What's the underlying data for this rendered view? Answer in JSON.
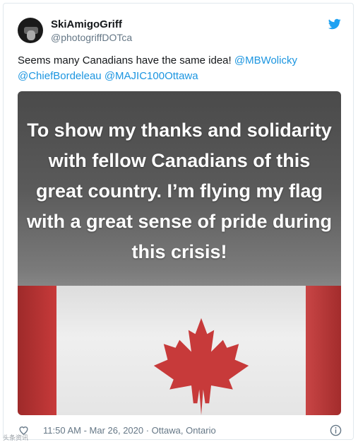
{
  "tweet": {
    "display_name": "SkiAmigoGriff",
    "handle": "@photogriffDOTca",
    "text_intro": "Seems many Canadians have the same idea! ",
    "mentions": [
      "@MBWolicky",
      "@ChiefBordeleau",
      "@MAJIC100Ottawa"
    ],
    "image_caption": "To show my thanks and solidarity with fellow Canadians of this great country. I’m flying my flag with a great sense of pride during this crisis!",
    "timestamp": "11:50 AM - Mar 26, 2020 · Ottawa, Ontario"
  },
  "icons": {
    "brand": "twitter-bird-icon",
    "like": "heart-icon",
    "info": "info-icon"
  },
  "colors": {
    "link": "#1b95e0",
    "brand": "#1da1f2",
    "text": "#14171a",
    "muted": "#657786",
    "flag_red": "#c73a3a"
  },
  "watermark": "头条资讯"
}
